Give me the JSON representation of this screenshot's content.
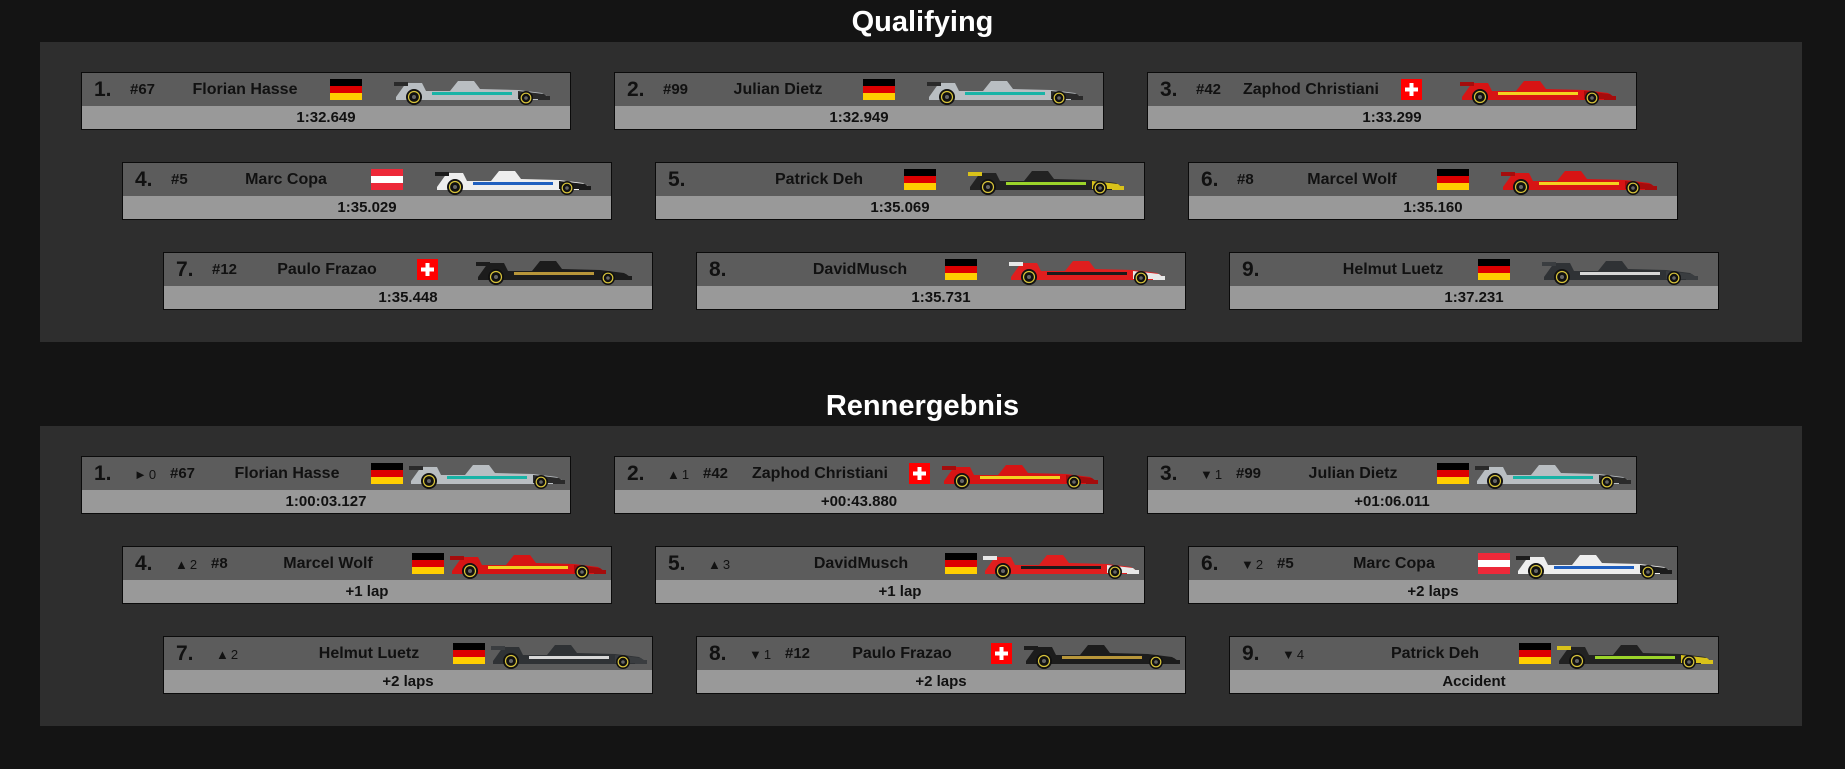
{
  "sections": {
    "qualifying_title": "Qualifying",
    "race_title": "Rennergebnis"
  },
  "qualifying": [
    {
      "pos": "1.",
      "num": "#67",
      "name": "Florian Hasse",
      "flag": "germany",
      "car": "silver-teal",
      "result": "1:32.649"
    },
    {
      "pos": "2.",
      "num": "#99",
      "name": "Julian Dietz",
      "flag": "germany",
      "car": "silver-teal",
      "result": "1:32.949"
    },
    {
      "pos": "3.",
      "num": "#42",
      "name": "Zaphod Christiani",
      "flag": "switzerland",
      "car": "red",
      "result": "1:33.299"
    },
    {
      "pos": "4.",
      "num": "#5",
      "name": "Marc Copa",
      "flag": "austria",
      "car": "white-blue",
      "result": "1:35.029"
    },
    {
      "pos": "5.",
      "num": "",
      "name": "Patrick Deh",
      "flag": "germany",
      "car": "black-green",
      "result": "1:35.069"
    },
    {
      "pos": "6.",
      "num": "#8",
      "name": "Marcel Wolf",
      "flag": "germany",
      "car": "red",
      "result": "1:35.160"
    },
    {
      "pos": "7.",
      "num": "#12",
      "name": "Paulo Frazao",
      "flag": "switzerland",
      "car": "black-gold",
      "result": "1:35.448"
    },
    {
      "pos": "8.",
      "num": "",
      "name": "DavidMusch",
      "flag": "germany",
      "car": "red-black",
      "result": "1:35.731"
    },
    {
      "pos": "9.",
      "num": "",
      "name": "Helmut Luetz",
      "flag": "germany",
      "car": "dark-grey",
      "result": "1:37.231"
    }
  ],
  "race": [
    {
      "pos": "1.",
      "chg_sym": "►",
      "chg_cnt": "0",
      "num": "#67",
      "name": "Florian Hasse",
      "flag": "germany",
      "car": "silver-teal",
      "result": "1:00:03.127"
    },
    {
      "pos": "2.",
      "chg_sym": "▲",
      "chg_cnt": "1",
      "num": "#42",
      "name": "Zaphod Christiani",
      "flag": "switzerland",
      "car": "red",
      "result": "+00:43.880"
    },
    {
      "pos": "3.",
      "chg_sym": "▼",
      "chg_cnt": "1",
      "num": "#99",
      "name": "Julian Dietz",
      "flag": "germany",
      "car": "silver-teal",
      "result": "+01:06.011"
    },
    {
      "pos": "4.",
      "chg_sym": "▲",
      "chg_cnt": "2",
      "num": "#8",
      "name": "Marcel Wolf",
      "flag": "germany",
      "car": "red",
      "result": "+1 lap"
    },
    {
      "pos": "5.",
      "chg_sym": "▲",
      "chg_cnt": "3",
      "num": "",
      "name": "DavidMusch",
      "flag": "germany",
      "car": "red-black",
      "result": "+1 lap"
    },
    {
      "pos": "6.",
      "chg_sym": "▼",
      "chg_cnt": "2",
      "num": "#5",
      "name": "Marc Copa",
      "flag": "austria",
      "car": "white-blue",
      "result": "+2 laps"
    },
    {
      "pos": "7.",
      "chg_sym": "▲",
      "chg_cnt": "2",
      "num": "",
      "name": "Helmut Luetz",
      "flag": "germany",
      "car": "dark-grey",
      "result": "+2 laps"
    },
    {
      "pos": "8.",
      "chg_sym": "▼",
      "chg_cnt": "1",
      "num": "#12",
      "name": "Paulo Frazao",
      "flag": "switzerland",
      "car": "black-gold",
      "result": "+2 laps"
    },
    {
      "pos": "9.",
      "chg_sym": "▼",
      "chg_cnt": "4",
      "num": "",
      "name": "Patrick Deh",
      "flag": "germany",
      "car": "black-green",
      "result": "Accident"
    }
  ],
  "car_colors": {
    "silver-teal": {
      "body": "#b9bec2",
      "accent": "#19b3a6",
      "nose": "#2a2a2a"
    },
    "red": {
      "body": "#d71414",
      "accent": "#f4d21f",
      "nose": "#a50c0c"
    },
    "white-blue": {
      "body": "#eeeeee",
      "accent": "#1f5fbf",
      "nose": "#1b1b1b"
    },
    "black-green": {
      "body": "#222222",
      "accent": "#9bd42a",
      "nose": "#d9c21a"
    },
    "black-gold": {
      "body": "#1c1c1c",
      "accent": "#b8963a",
      "nose": "#1c1c1c"
    },
    "red-black": {
      "body": "#e01e1e",
      "accent": "#1a1a1a",
      "nose": "#e8e8e8"
    },
    "dark-grey": {
      "body": "#2f3235",
      "accent": "#d8d8d8",
      "nose": "#3a3d40"
    }
  }
}
